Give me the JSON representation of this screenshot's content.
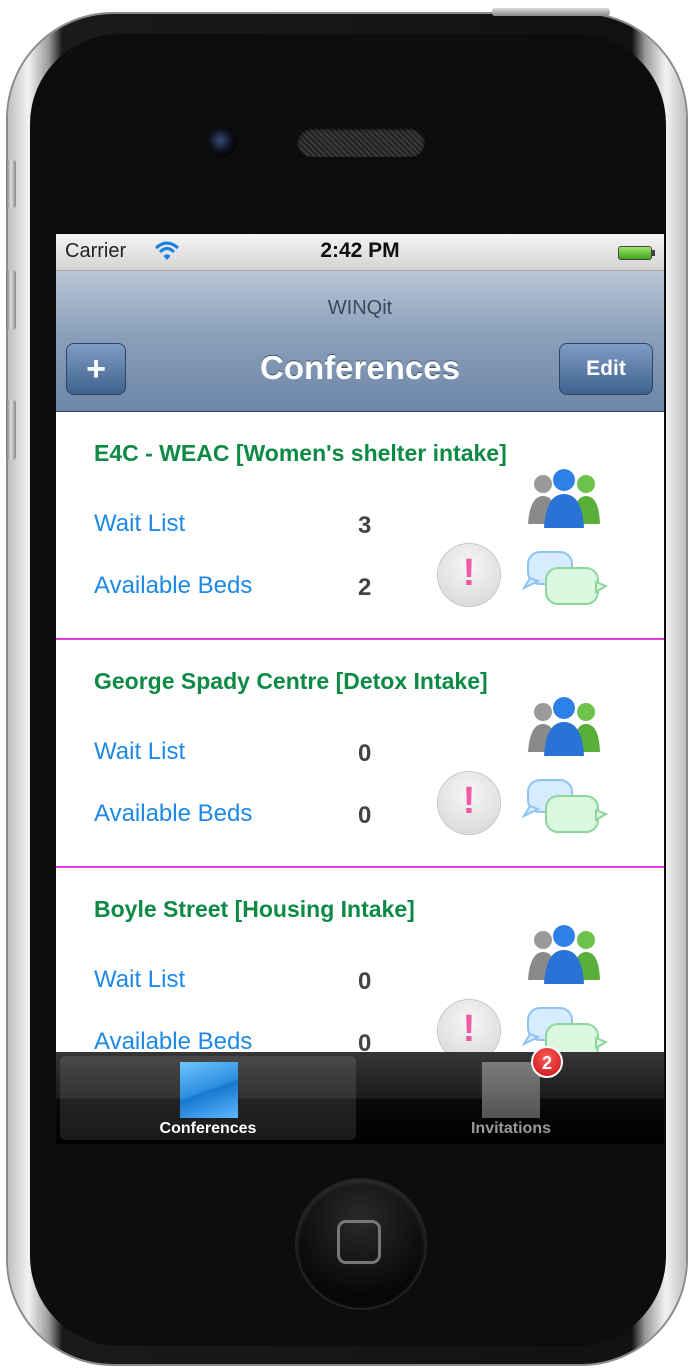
{
  "statusbar": {
    "carrier": "Carrier",
    "time": "2:42 PM"
  },
  "navbar": {
    "prompt": "WINQit",
    "title": "Conferences",
    "add_label": "+",
    "edit_label": "Edit"
  },
  "conferences": [
    {
      "title": "E4C - WEAC [Women's shelter intake]",
      "wait_label": "Wait List",
      "wait_value": "3",
      "beds_label": "Available Beds",
      "beds_value": "2"
    },
    {
      "title": "George Spady Centre [Detox Intake]",
      "wait_label": "Wait List",
      "wait_value": "0",
      "beds_label": "Available Beds",
      "beds_value": "0"
    },
    {
      "title": "Boyle Street [Housing Intake]",
      "wait_label": "Wait List",
      "wait_value": "0",
      "beds_label": "Available Beds",
      "beds_value": "0"
    }
  ],
  "alert_glyph": "!",
  "tabbar": {
    "tabs": [
      {
        "label": "Conferences",
        "selected": true
      },
      {
        "label": "Invitations",
        "badge": "2"
      }
    ]
  },
  "icons": [
    "wifi-icon",
    "battery-icon",
    "alert-icon",
    "people-icon",
    "chat-icon",
    "home-button-icon"
  ],
  "colors": {
    "title_green": "#0d8a45",
    "label_blue": "#1e88e5",
    "separator": "#e33de3",
    "badge_red": "#d61a1a"
  }
}
